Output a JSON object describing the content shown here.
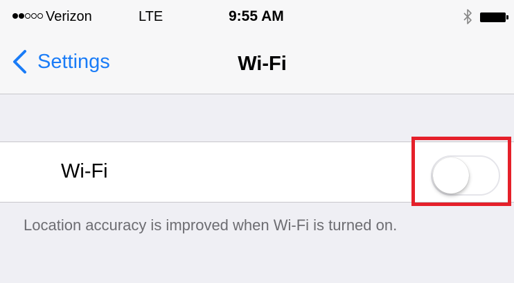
{
  "status_bar": {
    "signal": {
      "filled": 2,
      "total": 5
    },
    "carrier": "Verizon",
    "network": "LTE",
    "time": "9:55 AM",
    "bluetooth_icon": "bluetooth-icon",
    "battery_icon": "battery-icon",
    "battery_level": 1.0
  },
  "nav": {
    "back_label": "Settings",
    "back_icon": "chevron-left-icon",
    "title": "Wi-Fi"
  },
  "wifi_cell": {
    "label": "Wi-Fi",
    "toggle_on": false
  },
  "footer": {
    "note": "Location accuracy is improved when Wi-Fi is turned on."
  },
  "colors": {
    "accent": "#1a7cf7",
    "highlight": "#e5202a",
    "background": "#efeff4"
  }
}
